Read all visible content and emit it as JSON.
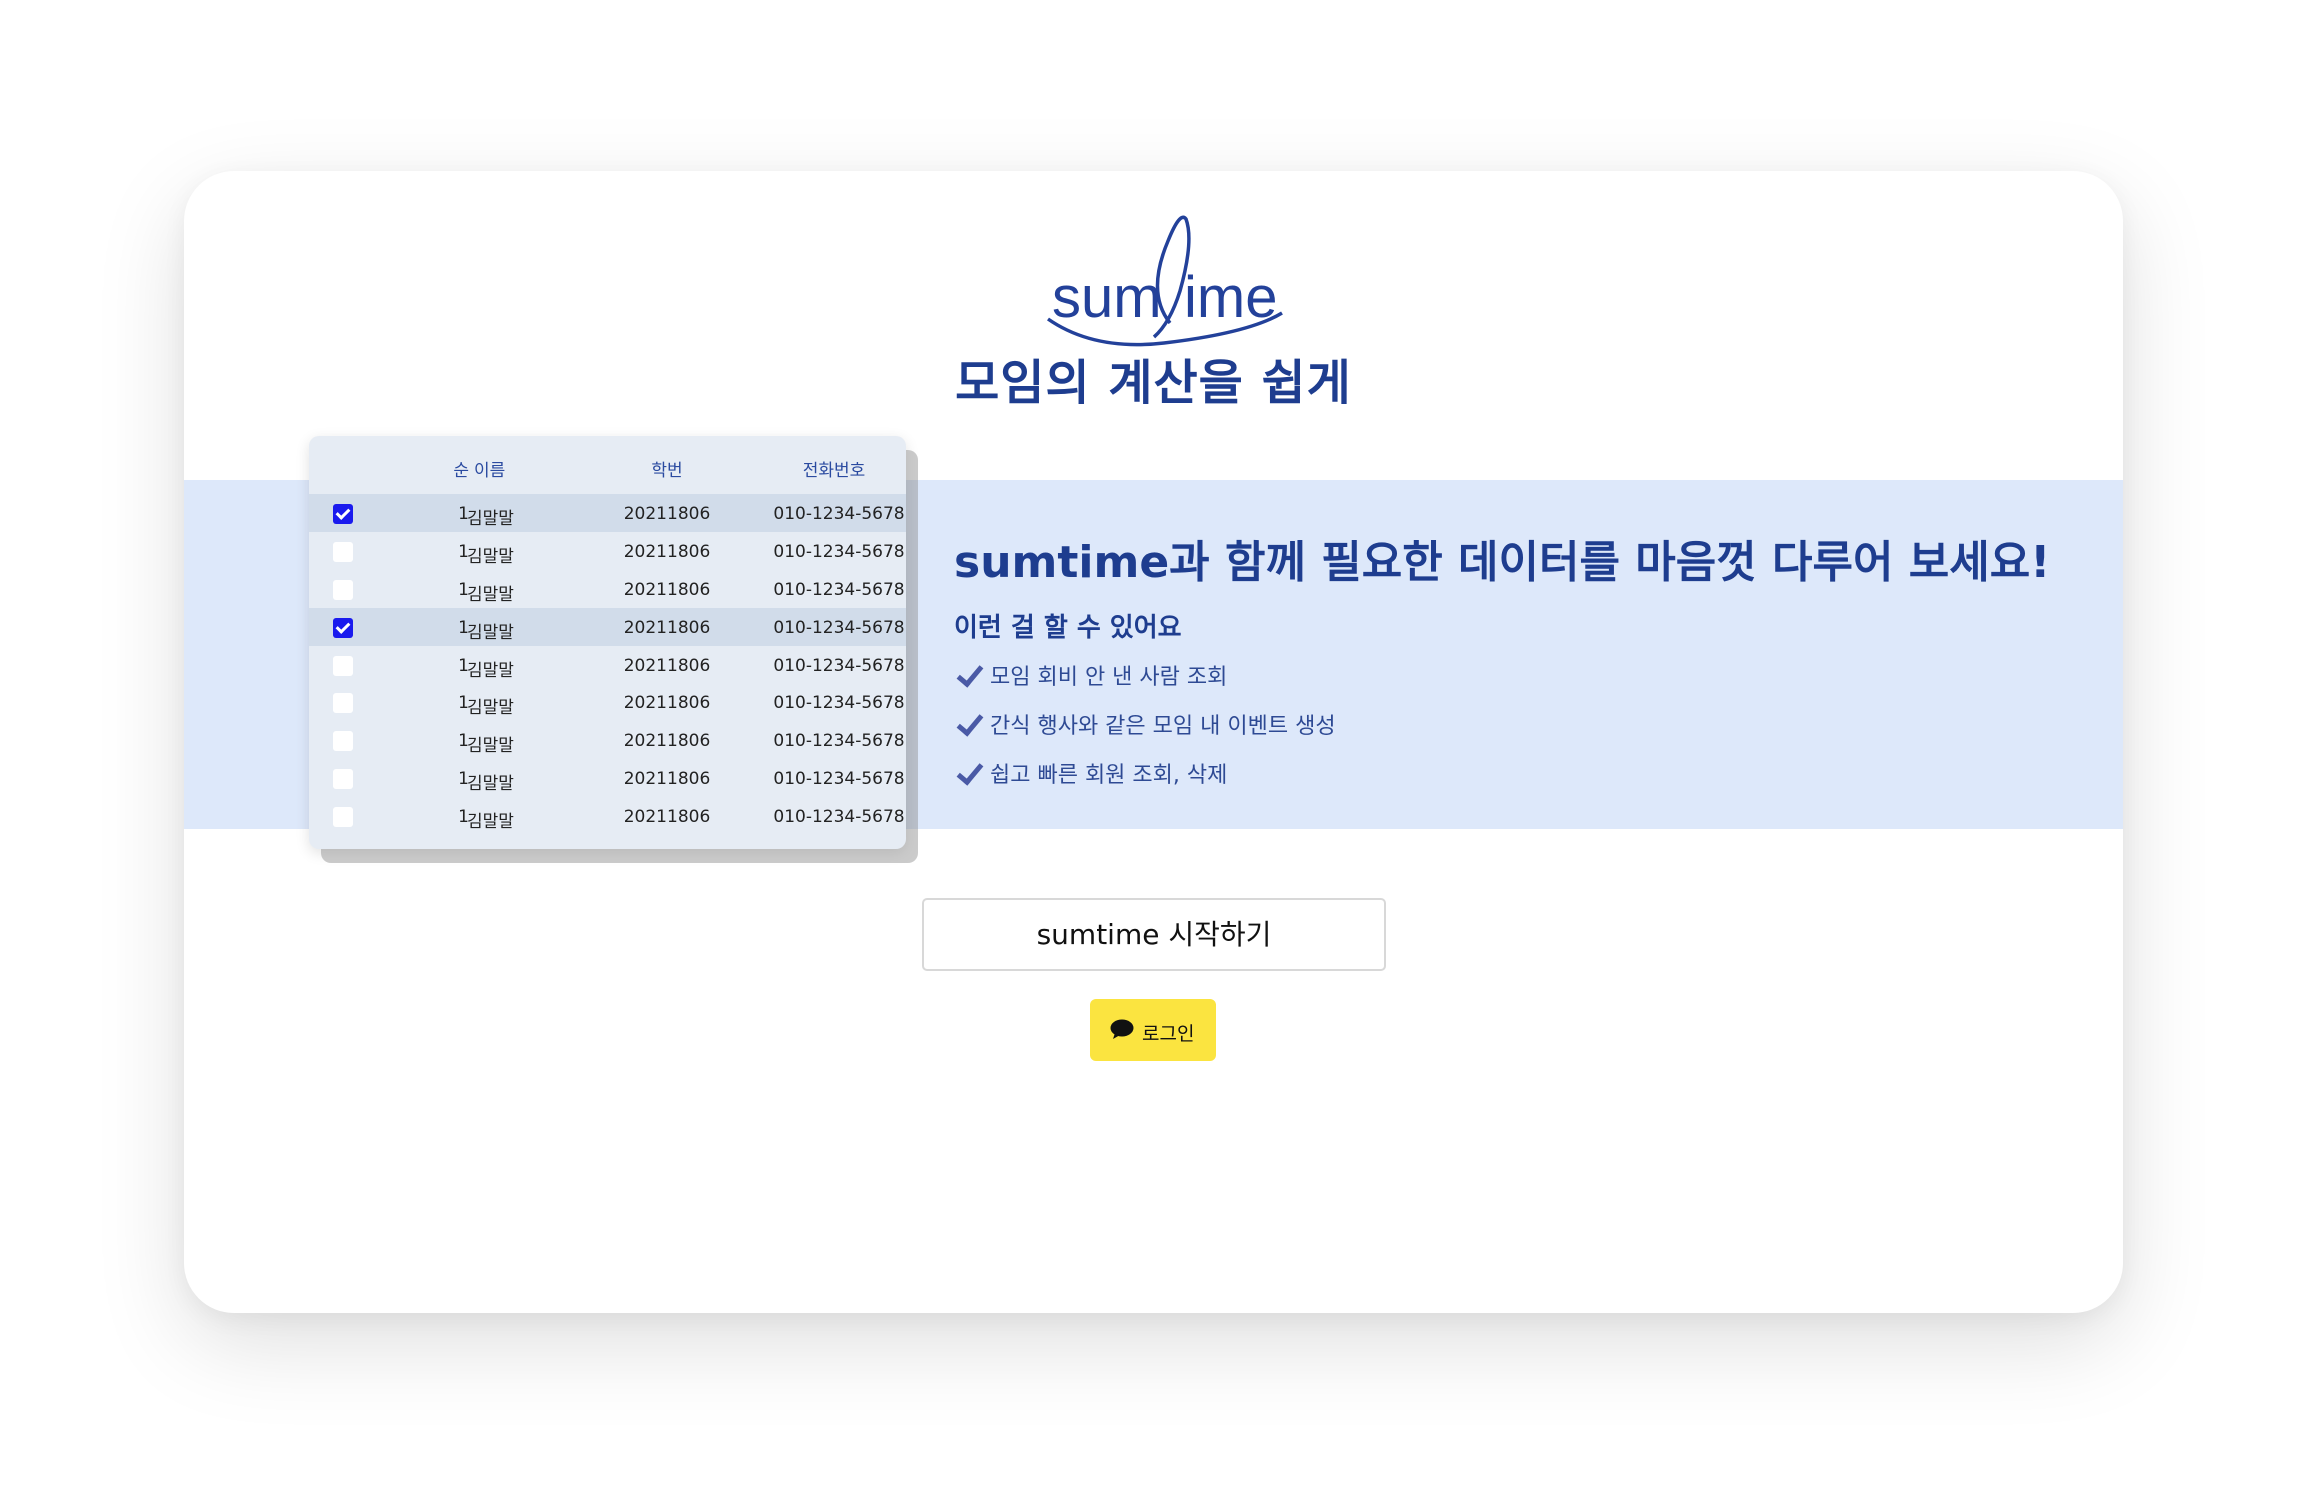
{
  "brand": {
    "logo_text": "sumtime",
    "tagline": "모임의 계산을 쉽게",
    "color": "#1e3d8f"
  },
  "table": {
    "headers": {
      "num": "순",
      "name": "이름",
      "id": "학번",
      "phone": "전화번호"
    },
    "rows": [
      {
        "checked": true,
        "num": "1",
        "name": "김말말",
        "id": "20211806",
        "phone": "010-1234-5678"
      },
      {
        "checked": false,
        "num": "1",
        "name": "김말말",
        "id": "20211806",
        "phone": "010-1234-5678"
      },
      {
        "checked": false,
        "num": "1",
        "name": "김말말",
        "id": "20211806",
        "phone": "010-1234-5678"
      },
      {
        "checked": true,
        "num": "1",
        "name": "김말말",
        "id": "20211806",
        "phone": "010-1234-5678"
      },
      {
        "checked": false,
        "num": "1",
        "name": "김말말",
        "id": "20211806",
        "phone": "010-1234-5678"
      },
      {
        "checked": false,
        "num": "1",
        "name": "김말말",
        "id": "20211806",
        "phone": "010-1234-5678"
      },
      {
        "checked": false,
        "num": "1",
        "name": "김말말",
        "id": "20211806",
        "phone": "010-1234-5678"
      },
      {
        "checked": false,
        "num": "1",
        "name": "김말말",
        "id": "20211806",
        "phone": "010-1234-5678"
      },
      {
        "checked": false,
        "num": "1",
        "name": "김말말",
        "id": "20211806",
        "phone": "010-1234-5678"
      }
    ]
  },
  "hero": {
    "headline": "sumtime과 함께 필요한 데이터를 마음껏 다루어 보세요!",
    "subhead": "이런 걸 할 수 있어요",
    "features": [
      {
        "icon": "check-icon",
        "text": "모임 회비 안 낸 사람 조회"
      },
      {
        "icon": "check-icon",
        "text": "간식 행사와 같은 모임 내 이벤트 생성"
      },
      {
        "icon": "check-icon",
        "text": "쉽고 빠른 회원 조회, 삭제"
      }
    ]
  },
  "actions": {
    "start_label": "sumtime 시작하기",
    "login_label": "로그인",
    "login_icon": "speech-bubble-icon",
    "login_color": "#fbe440"
  }
}
